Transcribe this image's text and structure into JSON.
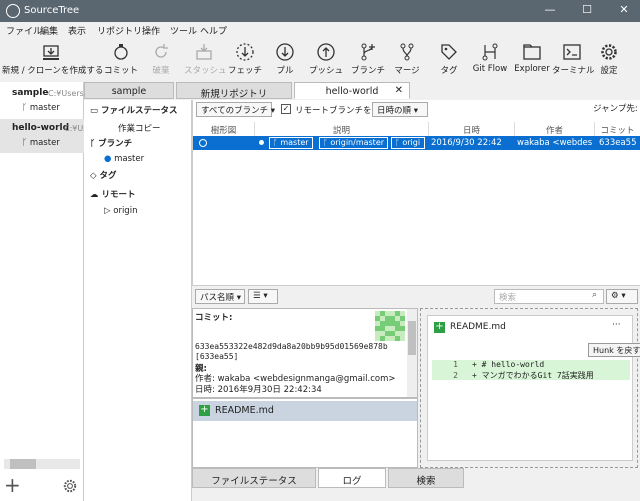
{
  "window": {
    "title": "SourceTree",
    "minimize": "—",
    "maximize": "☐",
    "close": "✕"
  },
  "menu": [
    "ファイル",
    "編集",
    "表示",
    "リポジトリ",
    "操作",
    "ツール",
    "ヘルプ"
  ],
  "toolbar": [
    {
      "label": "新規 / クローンを作成する",
      "icon": "new-clone-icon",
      "enabled": true
    },
    {
      "label": "コミット",
      "icon": "commit-icon",
      "enabled": true
    },
    {
      "label": "破棄",
      "icon": "discard-icon",
      "enabled": false
    },
    {
      "label": "スタッシュ",
      "icon": "stash-icon",
      "enabled": false
    },
    {
      "label": "フェッチ",
      "icon": "fetch-icon",
      "enabled": true
    },
    {
      "label": "プル",
      "icon": "pull-icon",
      "enabled": true
    },
    {
      "label": "プッシュ",
      "icon": "push-icon",
      "enabled": true
    },
    {
      "label": "ブランチ",
      "icon": "branch-icon",
      "enabled": true
    },
    {
      "label": "マージ",
      "icon": "merge-icon",
      "enabled": true
    },
    {
      "label": "タグ",
      "icon": "tag-icon",
      "enabled": true
    },
    {
      "label": "Git Flow",
      "icon": "git-flow-icon",
      "enabled": true
    },
    {
      "label": "Explorer",
      "icon": "explorer-icon",
      "enabled": true
    },
    {
      "label": "ターミナル",
      "icon": "terminal-icon",
      "enabled": true
    },
    {
      "label": "設定",
      "icon": "settings-icon",
      "enabled": true
    }
  ],
  "repos": [
    {
      "name": "sample",
      "path": "C:¥Users¥",
      "branch": "master"
    },
    {
      "name": "hello-world",
      "path": "C:¥Us",
      "branch": "master"
    }
  ],
  "tabs": [
    {
      "label": "sample"
    },
    {
      "label": "新規リポジトリ"
    },
    {
      "label": "hello-world",
      "close": "✕"
    }
  ],
  "tree": {
    "file_status": "ファイルステータス",
    "working_copy": "作業コピー",
    "branches": "ブランチ",
    "master": "master",
    "tags": "タグ",
    "remotes": "リモート",
    "origin": "origin"
  },
  "log": {
    "branch_filter": "すべてのブランチ",
    "show_remote_label": "リモートブランチを表示",
    "show_remote_checked": true,
    "order": "日時の順",
    "jump_to": "ジャンプ先:",
    "columns": [
      "樹形図",
      "説明",
      "日時",
      "作者",
      "コミット"
    ],
    "rows": [
      {
        "refs": [
          "master",
          "origin/master",
          "origi"
        ],
        "date": "2016/9/30  22:42",
        "author": "wakaba <webdesi",
        "commit": "633ea55"
      }
    ]
  },
  "bottom": {
    "sort": "パス名順",
    "search_placeholder": "検索",
    "details": {
      "commit_label": "コミット:",
      "commit_hash": "633ea553322e482d9da8a20bb9b95d01569e878b",
      "commit_short": "[633ea55]",
      "parent_label": "親:",
      "author_line": "作者: wakaba <webdesignmanga@gmail.com>",
      "date_line": "日時: 2016年9月30日 22:42:34"
    },
    "files": [
      "README.md"
    ],
    "diff": {
      "file": "README.md",
      "menu": "···",
      "hunk_button": "Hunk を戻す",
      "lines": [
        {
          "no": "1",
          "text": "+ # hello-world"
        },
        {
          "no": "2",
          "text": "+ マンガでわかるGit 7話実践用"
        }
      ]
    }
  },
  "bottom_tabs": [
    "ファイルステータス",
    "ログ",
    "検索"
  ]
}
